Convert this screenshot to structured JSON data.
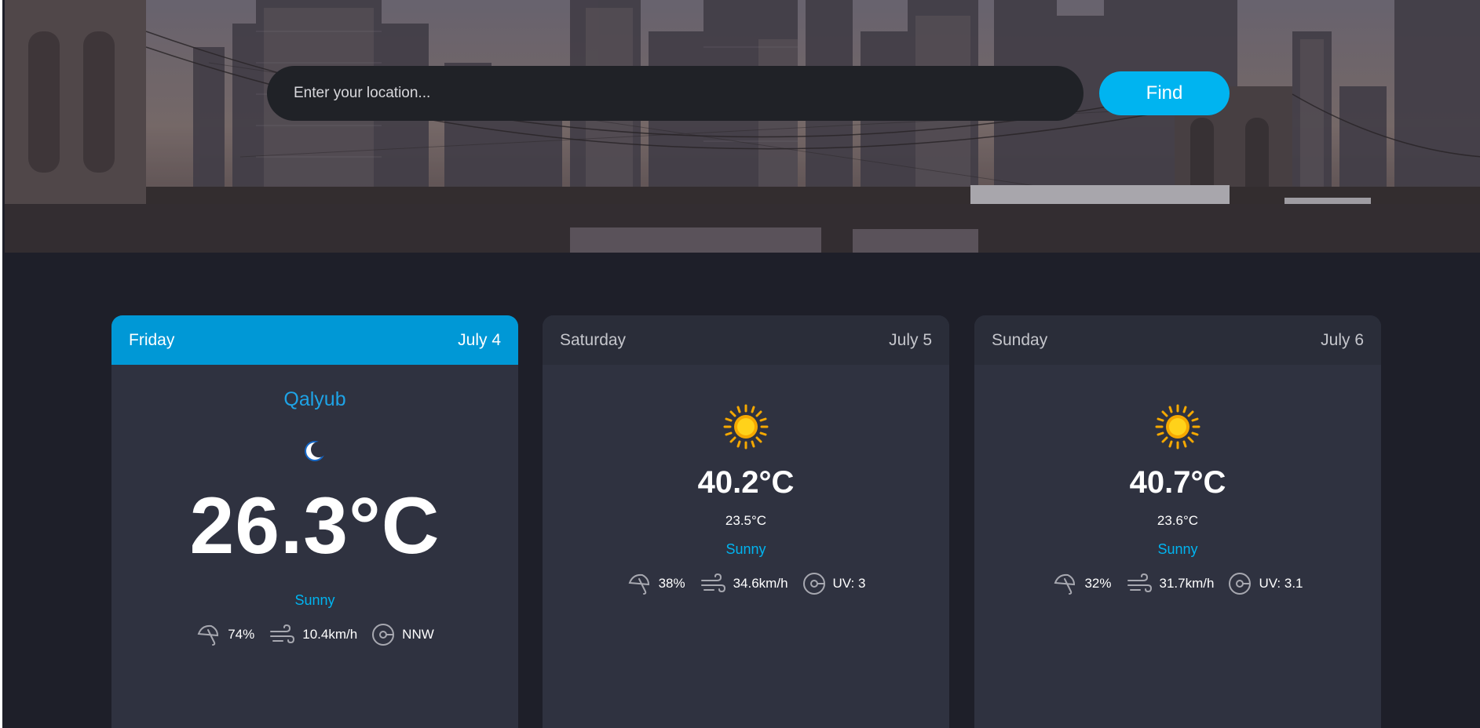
{
  "search": {
    "placeholder": "Enter your location...",
    "value": "",
    "button_label": "Find"
  },
  "colors": {
    "accent": "#00b4f0",
    "today_header": "#0098d6",
    "card_bg": "#2f3240",
    "page_bg": "#1e1f29"
  },
  "days": [
    {
      "day": "Friday",
      "date": "July 4",
      "city": "Qalyub",
      "icon": "moon-icon",
      "temp": "26.3°C",
      "condition": "Sunny",
      "rain": "74%",
      "wind": "10.4km/h",
      "direction": "NNW"
    },
    {
      "day": "Saturday",
      "date": "July 5",
      "icon": "sun-icon",
      "max_temp": "40.2°C",
      "min_temp": "23.5°C",
      "condition": "Sunny",
      "rain": "38%",
      "wind": "34.6km/h",
      "uv": "UV: 3"
    },
    {
      "day": "Sunday",
      "date": "July 6",
      "icon": "sun-icon",
      "max_temp": "40.7°C",
      "min_temp": "23.6°C",
      "condition": "Sunny",
      "rain": "32%",
      "wind": "31.7km/h",
      "uv": "UV: 3.1"
    }
  ]
}
